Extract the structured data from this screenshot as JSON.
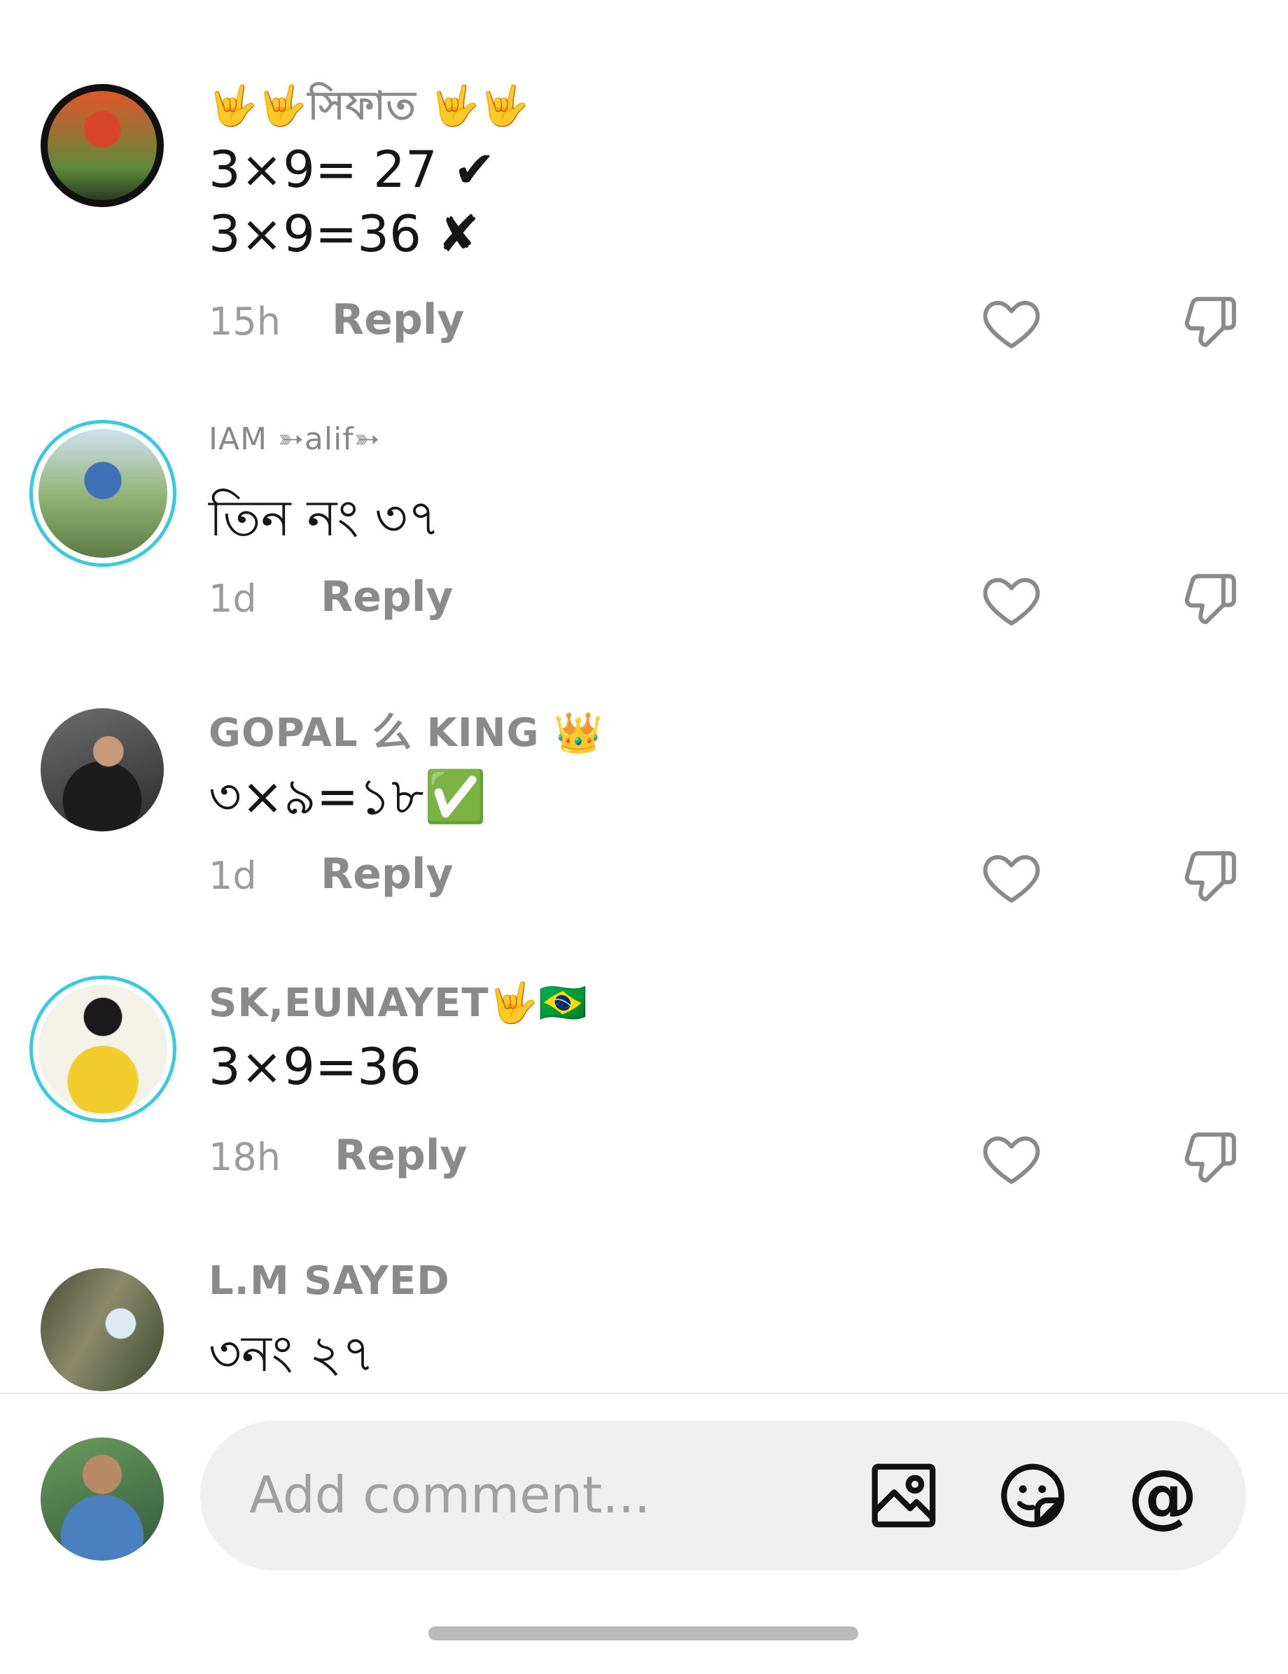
{
  "comments": [
    {
      "username": "🤟🤟সিফাত 🤟🤟",
      "lines": [
        "3×9= 27 ✔",
        "3×9=36 ✘"
      ],
      "time": "15h",
      "reply": "Reply"
    },
    {
      "username": "IAM ➳alif➳",
      "lines": [
        "তিন নং ৩৭"
      ],
      "time": "1d",
      "reply": "Reply"
    },
    {
      "username": "GOPAL 么 KING 👑",
      "lines": [
        "৩×৯=১৮✅"
      ],
      "time": "1d",
      "reply": "Reply"
    },
    {
      "username": "SK,EUNAYET🤟🇧🇷",
      "lines": [
        "3×9=36"
      ],
      "time": "18h",
      "reply": "Reply"
    },
    {
      "username": "L.M SAYED",
      "lines": [
        "৩নং ২৭"
      ]
    }
  ],
  "composer": {
    "placeholder": "Add comment...",
    "icons": [
      "image-icon",
      "sticker-icon",
      "mention-icon"
    ],
    "mention_symbol": "@"
  },
  "colors": {
    "avatar_ring": "#3cc8e0",
    "text": "#161616",
    "muted": "#8a8a8a"
  }
}
